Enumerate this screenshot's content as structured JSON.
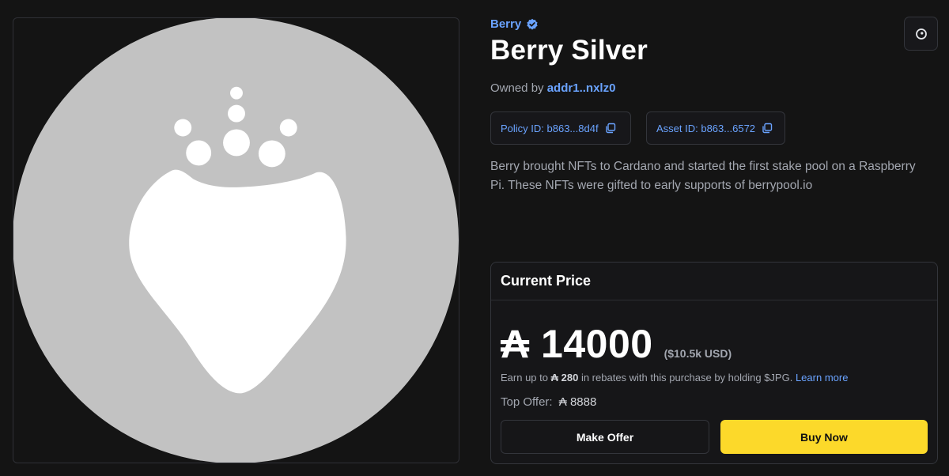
{
  "collection": {
    "name": "Berry",
    "verified_icon": "verified-badge-icon"
  },
  "asset": {
    "title": "Berry Silver",
    "owned_prefix": "Owned by",
    "owner": "addr1..nxlz0",
    "policy_id_label": "Policy ID: b863...8d4f",
    "asset_id_label": "Asset ID: b863...6572",
    "description": "Berry brought NFTs to Cardano and started the first stake pool on a Raspberry Pi. These NFTs were gifted to early supports of berrypool.io"
  },
  "price_card": {
    "header": "Current Price",
    "currency_symbol": "₳",
    "price": "14000",
    "usd": "($10.5k USD)",
    "rebate_prefix": "Earn up to",
    "rebate_amount": "₳ 280",
    "rebate_suffix": "in rebates with this purchase by holding $JPG.",
    "learn_more": "Learn more",
    "top_offer_label": "Top Offer:",
    "top_offer_value": "₳ 8888",
    "make_offer_label": "Make Offer",
    "buy_now_label": "Buy Now"
  },
  "colors": {
    "background": "#141414",
    "accent_blue": "#6aa3ff",
    "buy_yellow": "#fcd92a",
    "nft_circle": "#c2c2c2"
  },
  "icons": {
    "copy": "copy-icon",
    "action": "circle-dot-icon"
  }
}
